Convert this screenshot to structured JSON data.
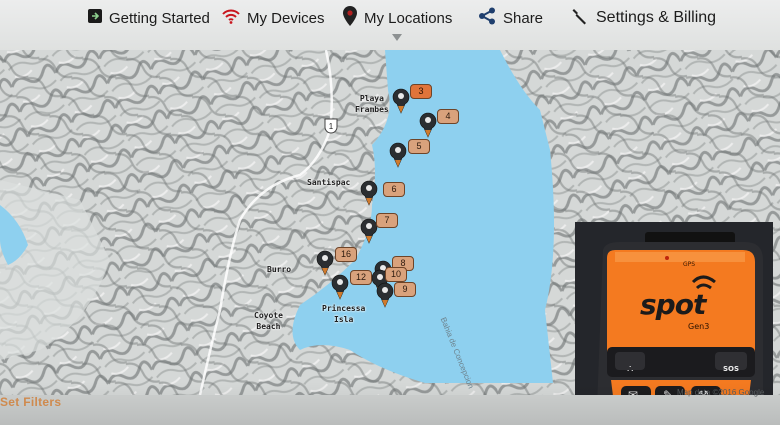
{
  "nav": {
    "getting_started": "Getting Started",
    "my_devices": "My Devices",
    "my_locations": "My Locations",
    "share": "Share",
    "settings_billing": "Settings & Billing"
  },
  "map": {
    "places": {
      "playa_frambes": "Playa\nFrambes",
      "santispac": "Santispac",
      "burro": "Burro",
      "coyote_beach": "Coyote\nBeach",
      "princessa_isla": "Princessa\nIsla"
    },
    "bay_name": "Bahia de Concepcion",
    "route_number": "1",
    "markers": [
      "3",
      "4",
      "5",
      "6",
      "7",
      "16",
      "8",
      "10",
      "12",
      "9"
    ],
    "attribution": "Map data ©2016 Google"
  },
  "device": {
    "brand": "spot",
    "model": "Gen3",
    "gps_label": "GPS",
    "sos_label": "SOS"
  },
  "filters_label": "Set Filters",
  "colors": {
    "water": "#8ed0ef",
    "marker_tag": "#d9a27c",
    "marker_highlight": "#e0743a",
    "device_orange": "#f47a20"
  }
}
